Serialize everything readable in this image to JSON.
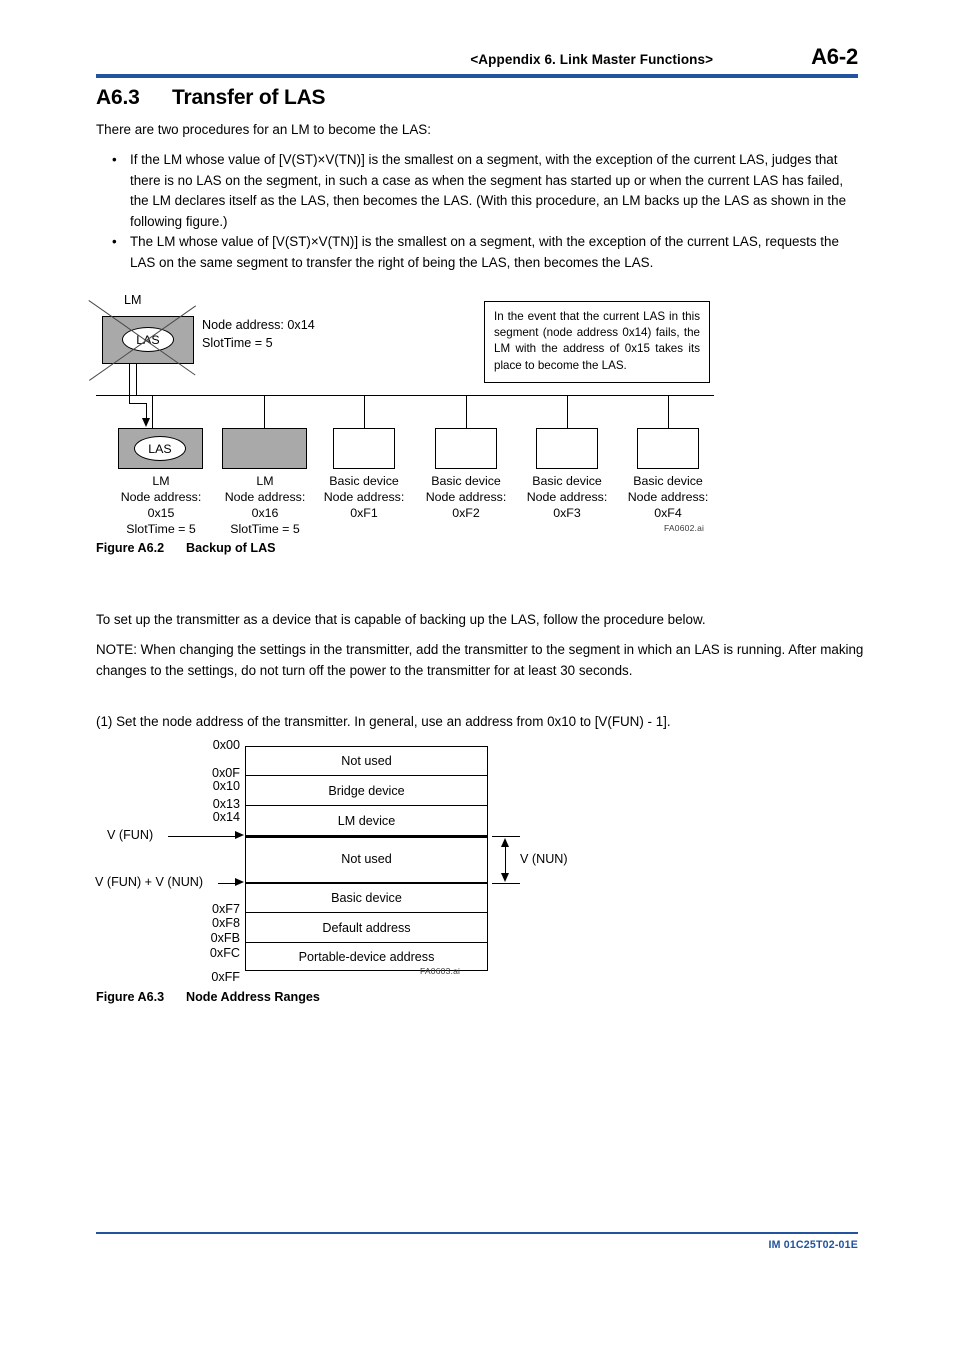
{
  "header": {
    "center_title": "<Appendix 6.  Link Master Functions>",
    "page_number": "A6-2"
  },
  "section": {
    "number": "A6.3",
    "title": "Transfer of LAS"
  },
  "intro_paragraph": "There are two procedures for an LM to become the LAS:",
  "bullets": [
    {
      "marker": "•",
      "text": "If the LM whose value of [V(ST)×V(TN)] is the smallest on a segment, with the exception of the current LAS, judges that there is no LAS on the segment, in such a case as when the segment has started up or when the current LAS has failed, the LM declares itself as the LAS, then becomes the LAS.  (With this procedure, an LM backs up the LAS as shown in the following figure.)"
    },
    {
      "marker": "•",
      "text": "The LM whose value of [V(ST)×V(TN)] is the smallest on a segment, with the exception of the current LAS, requests the LAS on the same segment to transfer the right of being the LAS, then becomes the LAS."
    }
  ],
  "figure_a62": {
    "caption_id": "Figure A6.2",
    "caption_title": "Backup of LAS",
    "figure_file": "FA0602.ai",
    "failed_device": {
      "top_label": "LM",
      "badge": "LAS",
      "node_address": "Node address: 0x14",
      "slot_time": "SlotTime = 5"
    },
    "callout": "In the event that the current LAS in this segment (node address 0x14) fails, the LM with the address of 0x15 takes its place to become the LAS.",
    "devices": [
      {
        "type": "LM",
        "badge": "LAS",
        "filled": true,
        "address_label": "Node address:",
        "address": "0x15",
        "slot_time": "SlotTime = 5"
      },
      {
        "type": "LM",
        "badge": "",
        "filled": true,
        "address_label": "Node address:",
        "address": "0x16",
        "slot_time": "SlotTime = 5"
      },
      {
        "type": "Basic device",
        "badge": "",
        "filled": false,
        "address_label": "Node address:",
        "address": "0xF1",
        "slot_time": ""
      },
      {
        "type": "Basic device",
        "badge": "",
        "filled": false,
        "address_label": "Node address:",
        "address": "0xF2",
        "slot_time": ""
      },
      {
        "type": "Basic device",
        "badge": "",
        "filled": false,
        "address_label": "Node address:",
        "address": "0xF3",
        "slot_time": ""
      },
      {
        "type": "Basic device",
        "badge": "",
        "filled": false,
        "address_label": "Node address:",
        "address": "0xF4",
        "slot_time": ""
      }
    ]
  },
  "setup_paragraph": "To set up the transmitter as a device that is capable of backing up the LAS, follow the procedure below.",
  "note_paragraph": "NOTE: When changing the settings in the transmitter, add the transmitter to the segment in which an LAS is running.  After making changes to the settings, do not turn off the power to the transmitter for at least 30 seconds.",
  "step_1": "(1)  Set the node address of the transmitter.  In general, use an address from 0x10 to [V(FUN) - 1].",
  "figure_a63": {
    "caption_id": "Figure A6.3",
    "caption_title": "Node Address Ranges",
    "figure_file": "FA0603.ai",
    "rows": [
      {
        "label": "Not used"
      },
      {
        "label": "Bridge device"
      },
      {
        "label": "LM device"
      },
      {
        "label": "Not used"
      },
      {
        "label": "Basic device"
      },
      {
        "label": "Default address"
      },
      {
        "label": "Portable-device address"
      }
    ],
    "addresses": [
      "0x00",
      "0x0F",
      "0x10",
      "0x13",
      "0x14",
      "0xF7",
      "0xF8",
      "0xFB",
      "0xFC",
      "0xFF"
    ],
    "marker_vfun": "V (FUN)",
    "marker_vfun_vnun": "V (FUN) + V (NUN)",
    "marker_vnun": "V (NUN)"
  },
  "footer": {
    "document_code": "IM 01C25T02-01E"
  },
  "colors": {
    "rule_blue": "#21539f",
    "device_gray": "#a9a9a9"
  }
}
